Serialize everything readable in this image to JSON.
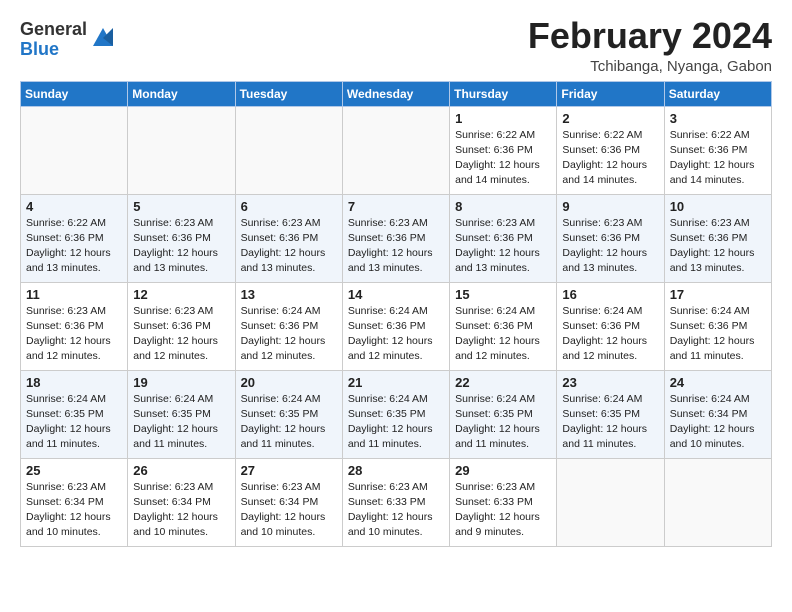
{
  "header": {
    "logo_general": "General",
    "logo_blue": "Blue",
    "month_title": "February 2024",
    "location": "Tchibanga, Nyanga, Gabon"
  },
  "days_of_week": [
    "Sunday",
    "Monday",
    "Tuesday",
    "Wednesday",
    "Thursday",
    "Friday",
    "Saturday"
  ],
  "weeks": [
    [
      {
        "day": "",
        "sunrise": "",
        "sunset": "",
        "daylight": ""
      },
      {
        "day": "",
        "sunrise": "",
        "sunset": "",
        "daylight": ""
      },
      {
        "day": "",
        "sunrise": "",
        "sunset": "",
        "daylight": ""
      },
      {
        "day": "",
        "sunrise": "",
        "sunset": "",
        "daylight": ""
      },
      {
        "day": "1",
        "sunrise": "Sunrise: 6:22 AM",
        "sunset": "Sunset: 6:36 PM",
        "daylight": "Daylight: 12 hours and 14 minutes."
      },
      {
        "day": "2",
        "sunrise": "Sunrise: 6:22 AM",
        "sunset": "Sunset: 6:36 PM",
        "daylight": "Daylight: 12 hours and 14 minutes."
      },
      {
        "day": "3",
        "sunrise": "Sunrise: 6:22 AM",
        "sunset": "Sunset: 6:36 PM",
        "daylight": "Daylight: 12 hours and 14 minutes."
      }
    ],
    [
      {
        "day": "4",
        "sunrise": "Sunrise: 6:22 AM",
        "sunset": "Sunset: 6:36 PM",
        "daylight": "Daylight: 12 hours and 13 minutes."
      },
      {
        "day": "5",
        "sunrise": "Sunrise: 6:23 AM",
        "sunset": "Sunset: 6:36 PM",
        "daylight": "Daylight: 12 hours and 13 minutes."
      },
      {
        "day": "6",
        "sunrise": "Sunrise: 6:23 AM",
        "sunset": "Sunset: 6:36 PM",
        "daylight": "Daylight: 12 hours and 13 minutes."
      },
      {
        "day": "7",
        "sunrise": "Sunrise: 6:23 AM",
        "sunset": "Sunset: 6:36 PM",
        "daylight": "Daylight: 12 hours and 13 minutes."
      },
      {
        "day": "8",
        "sunrise": "Sunrise: 6:23 AM",
        "sunset": "Sunset: 6:36 PM",
        "daylight": "Daylight: 12 hours and 13 minutes."
      },
      {
        "day": "9",
        "sunrise": "Sunrise: 6:23 AM",
        "sunset": "Sunset: 6:36 PM",
        "daylight": "Daylight: 12 hours and 13 minutes."
      },
      {
        "day": "10",
        "sunrise": "Sunrise: 6:23 AM",
        "sunset": "Sunset: 6:36 PM",
        "daylight": "Daylight: 12 hours and 13 minutes."
      }
    ],
    [
      {
        "day": "11",
        "sunrise": "Sunrise: 6:23 AM",
        "sunset": "Sunset: 6:36 PM",
        "daylight": "Daylight: 12 hours and 12 minutes."
      },
      {
        "day": "12",
        "sunrise": "Sunrise: 6:23 AM",
        "sunset": "Sunset: 6:36 PM",
        "daylight": "Daylight: 12 hours and 12 minutes."
      },
      {
        "day": "13",
        "sunrise": "Sunrise: 6:24 AM",
        "sunset": "Sunset: 6:36 PM",
        "daylight": "Daylight: 12 hours and 12 minutes."
      },
      {
        "day": "14",
        "sunrise": "Sunrise: 6:24 AM",
        "sunset": "Sunset: 6:36 PM",
        "daylight": "Daylight: 12 hours and 12 minutes."
      },
      {
        "day": "15",
        "sunrise": "Sunrise: 6:24 AM",
        "sunset": "Sunset: 6:36 PM",
        "daylight": "Daylight: 12 hours and 12 minutes."
      },
      {
        "day": "16",
        "sunrise": "Sunrise: 6:24 AM",
        "sunset": "Sunset: 6:36 PM",
        "daylight": "Daylight: 12 hours and 12 minutes."
      },
      {
        "day": "17",
        "sunrise": "Sunrise: 6:24 AM",
        "sunset": "Sunset: 6:36 PM",
        "daylight": "Daylight: 12 hours and 11 minutes."
      }
    ],
    [
      {
        "day": "18",
        "sunrise": "Sunrise: 6:24 AM",
        "sunset": "Sunset: 6:35 PM",
        "daylight": "Daylight: 12 hours and 11 minutes."
      },
      {
        "day": "19",
        "sunrise": "Sunrise: 6:24 AM",
        "sunset": "Sunset: 6:35 PM",
        "daylight": "Daylight: 12 hours and 11 minutes."
      },
      {
        "day": "20",
        "sunrise": "Sunrise: 6:24 AM",
        "sunset": "Sunset: 6:35 PM",
        "daylight": "Daylight: 12 hours and 11 minutes."
      },
      {
        "day": "21",
        "sunrise": "Sunrise: 6:24 AM",
        "sunset": "Sunset: 6:35 PM",
        "daylight": "Daylight: 12 hours and 11 minutes."
      },
      {
        "day": "22",
        "sunrise": "Sunrise: 6:24 AM",
        "sunset": "Sunset: 6:35 PM",
        "daylight": "Daylight: 12 hours and 11 minutes."
      },
      {
        "day": "23",
        "sunrise": "Sunrise: 6:24 AM",
        "sunset": "Sunset: 6:35 PM",
        "daylight": "Daylight: 12 hours and 11 minutes."
      },
      {
        "day": "24",
        "sunrise": "Sunrise: 6:24 AM",
        "sunset": "Sunset: 6:34 PM",
        "daylight": "Daylight: 12 hours and 10 minutes."
      }
    ],
    [
      {
        "day": "25",
        "sunrise": "Sunrise: 6:23 AM",
        "sunset": "Sunset: 6:34 PM",
        "daylight": "Daylight: 12 hours and 10 minutes."
      },
      {
        "day": "26",
        "sunrise": "Sunrise: 6:23 AM",
        "sunset": "Sunset: 6:34 PM",
        "daylight": "Daylight: 12 hours and 10 minutes."
      },
      {
        "day": "27",
        "sunrise": "Sunrise: 6:23 AM",
        "sunset": "Sunset: 6:34 PM",
        "daylight": "Daylight: 12 hours and 10 minutes."
      },
      {
        "day": "28",
        "sunrise": "Sunrise: 6:23 AM",
        "sunset": "Sunset: 6:33 PM",
        "daylight": "Daylight: 12 hours and 10 minutes."
      },
      {
        "day": "29",
        "sunrise": "Sunrise: 6:23 AM",
        "sunset": "Sunset: 6:33 PM",
        "daylight": "Daylight: 12 hours and 9 minutes."
      },
      {
        "day": "",
        "sunrise": "",
        "sunset": "",
        "daylight": ""
      },
      {
        "day": "",
        "sunrise": "",
        "sunset": "",
        "daylight": ""
      }
    ]
  ]
}
